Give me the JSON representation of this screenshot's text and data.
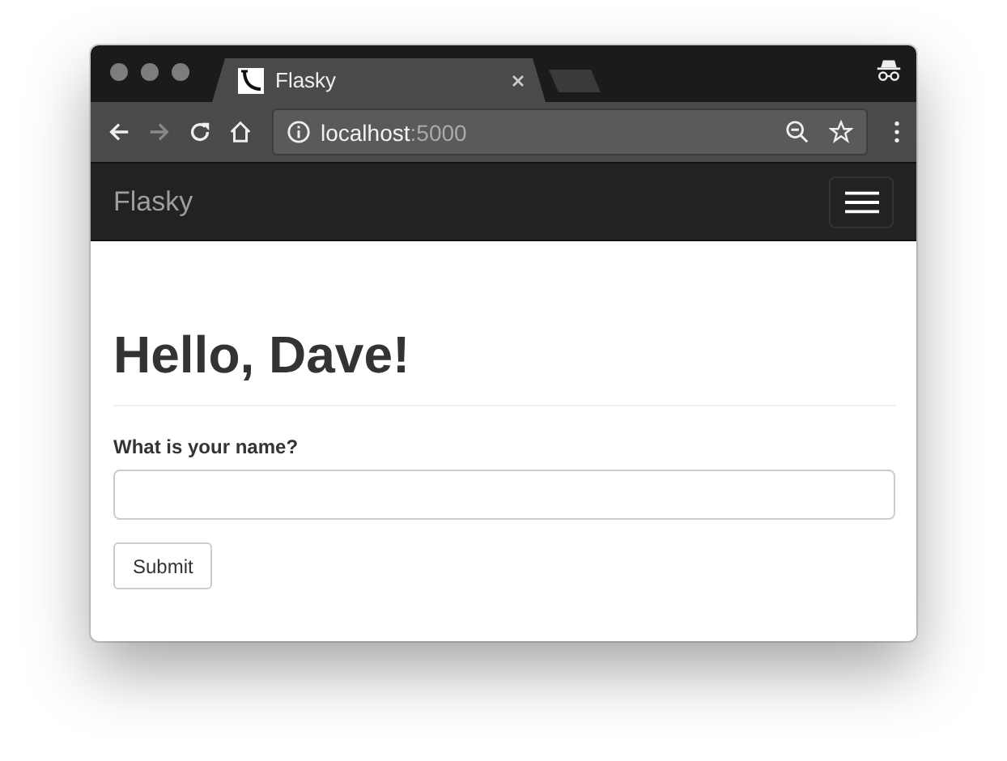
{
  "browser": {
    "tabs": [
      {
        "title": "Flasky",
        "selected": true
      }
    ],
    "back": {
      "disabled": false
    },
    "forward": {
      "disabled": true
    },
    "url": {
      "host": "localhost",
      "port": ":5000"
    }
  },
  "navbar": {
    "brand": "Flasky"
  },
  "page": {
    "heading": "Hello, Dave!",
    "form": {
      "label": "What is your name?",
      "button": "Submit"
    }
  }
}
